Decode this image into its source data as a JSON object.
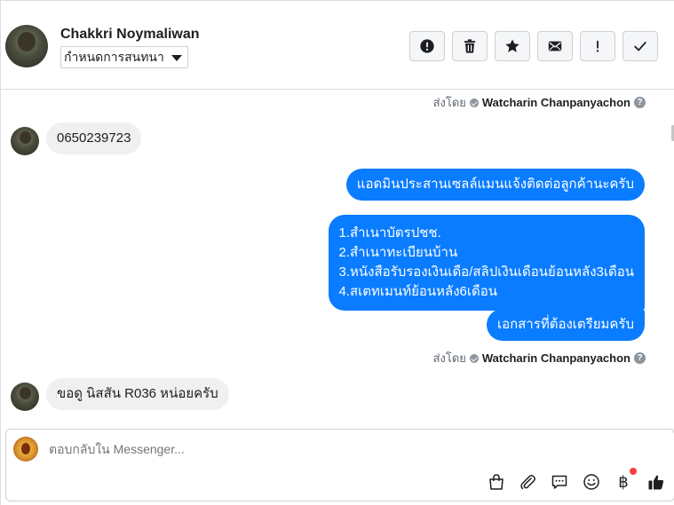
{
  "header": {
    "contact_name": "Chakkri Noymaliwan",
    "assign_label": "กำหนดการสนทนา",
    "actions": [
      {
        "name": "spam-button",
        "icon": "alert-circle-icon"
      },
      {
        "name": "delete-button",
        "icon": "trash-icon"
      },
      {
        "name": "star-button",
        "icon": "star-icon"
      },
      {
        "name": "mark-unread-button",
        "icon": "envelope-icon"
      },
      {
        "name": "follow-up-button",
        "icon": "exclamation-icon"
      },
      {
        "name": "done-button",
        "icon": "check-icon"
      }
    ]
  },
  "messages": {
    "sent_by_label": "ส่งโดย",
    "agent_name": "Watcharin Chanpanyachon",
    "help_glyph": "?",
    "in_1": "0650239723",
    "out_1": "แอดมินประสานเซลล์แมนแจ้งติดต่อลูกค้านะครับ",
    "out_2_lines": [
      "1.สำเนาบัตรปชช.",
      "2.สำเนาทะเบียนบ้าน",
      "3.หนังสือรับรองเงินเดือ/สลิปเงินเดือนย้อนหลัง3เดือน",
      "4.สเตทเมนท์ย้อนหลัง6เดือน"
    ],
    "out_3": "เอกสารที่ต้องเตรียมครับ",
    "in_2": "ขอดู นิสสัน R036 หน่อยครับ"
  },
  "composer": {
    "placeholder": "ตอบกลับใน Messenger...",
    "icons": [
      "shopping-bag-icon",
      "paperclip-icon",
      "saved-replies-icon",
      "emoji-icon",
      "baht-payment-icon",
      "thumbs-up-icon"
    ],
    "baht_glyph": "฿"
  },
  "colors": {
    "outgoing_bubble": "#0a7cff",
    "incoming_bubble": "#f0f0f0",
    "thumbs_up": "#1c1e21",
    "notification_dot": "#fa3e3e"
  }
}
